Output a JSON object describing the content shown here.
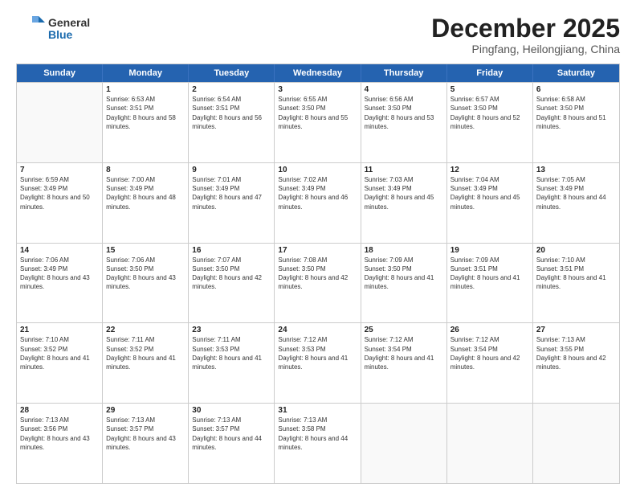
{
  "logo": {
    "general": "General",
    "blue": "Blue"
  },
  "title": "December 2025",
  "location": "Pingfang, Heilongjiang, China",
  "days_of_week": [
    "Sunday",
    "Monday",
    "Tuesday",
    "Wednesday",
    "Thursday",
    "Friday",
    "Saturday"
  ],
  "weeks": [
    [
      {
        "day": "",
        "empty": true
      },
      {
        "day": "1",
        "sunrise": "6:53 AM",
        "sunset": "3:51 PM",
        "daylight": "8 hours and 58 minutes."
      },
      {
        "day": "2",
        "sunrise": "6:54 AM",
        "sunset": "3:51 PM",
        "daylight": "8 hours and 56 minutes."
      },
      {
        "day": "3",
        "sunrise": "6:55 AM",
        "sunset": "3:50 PM",
        "daylight": "8 hours and 55 minutes."
      },
      {
        "day": "4",
        "sunrise": "6:56 AM",
        "sunset": "3:50 PM",
        "daylight": "8 hours and 53 minutes."
      },
      {
        "day": "5",
        "sunrise": "6:57 AM",
        "sunset": "3:50 PM",
        "daylight": "8 hours and 52 minutes."
      },
      {
        "day": "6",
        "sunrise": "6:58 AM",
        "sunset": "3:50 PM",
        "daylight": "8 hours and 51 minutes."
      }
    ],
    [
      {
        "day": "7",
        "sunrise": "6:59 AM",
        "sunset": "3:49 PM",
        "daylight": "8 hours and 50 minutes."
      },
      {
        "day": "8",
        "sunrise": "7:00 AM",
        "sunset": "3:49 PM",
        "daylight": "8 hours and 48 minutes."
      },
      {
        "day": "9",
        "sunrise": "7:01 AM",
        "sunset": "3:49 PM",
        "daylight": "8 hours and 47 minutes."
      },
      {
        "day": "10",
        "sunrise": "7:02 AM",
        "sunset": "3:49 PM",
        "daylight": "8 hours and 46 minutes."
      },
      {
        "day": "11",
        "sunrise": "7:03 AM",
        "sunset": "3:49 PM",
        "daylight": "8 hours and 45 minutes."
      },
      {
        "day": "12",
        "sunrise": "7:04 AM",
        "sunset": "3:49 PM",
        "daylight": "8 hours and 45 minutes."
      },
      {
        "day": "13",
        "sunrise": "7:05 AM",
        "sunset": "3:49 PM",
        "daylight": "8 hours and 44 minutes."
      }
    ],
    [
      {
        "day": "14",
        "sunrise": "7:06 AM",
        "sunset": "3:49 PM",
        "daylight": "8 hours and 43 minutes."
      },
      {
        "day": "15",
        "sunrise": "7:06 AM",
        "sunset": "3:50 PM",
        "daylight": "8 hours and 43 minutes."
      },
      {
        "day": "16",
        "sunrise": "7:07 AM",
        "sunset": "3:50 PM",
        "daylight": "8 hours and 42 minutes."
      },
      {
        "day": "17",
        "sunrise": "7:08 AM",
        "sunset": "3:50 PM",
        "daylight": "8 hours and 42 minutes."
      },
      {
        "day": "18",
        "sunrise": "7:09 AM",
        "sunset": "3:50 PM",
        "daylight": "8 hours and 41 minutes."
      },
      {
        "day": "19",
        "sunrise": "7:09 AM",
        "sunset": "3:51 PM",
        "daylight": "8 hours and 41 minutes."
      },
      {
        "day": "20",
        "sunrise": "7:10 AM",
        "sunset": "3:51 PM",
        "daylight": "8 hours and 41 minutes."
      }
    ],
    [
      {
        "day": "21",
        "sunrise": "7:10 AM",
        "sunset": "3:52 PM",
        "daylight": "8 hours and 41 minutes."
      },
      {
        "day": "22",
        "sunrise": "7:11 AM",
        "sunset": "3:52 PM",
        "daylight": "8 hours and 41 minutes."
      },
      {
        "day": "23",
        "sunrise": "7:11 AM",
        "sunset": "3:53 PM",
        "daylight": "8 hours and 41 minutes."
      },
      {
        "day": "24",
        "sunrise": "7:12 AM",
        "sunset": "3:53 PM",
        "daylight": "8 hours and 41 minutes."
      },
      {
        "day": "25",
        "sunrise": "7:12 AM",
        "sunset": "3:54 PM",
        "daylight": "8 hours and 41 minutes."
      },
      {
        "day": "26",
        "sunrise": "7:12 AM",
        "sunset": "3:54 PM",
        "daylight": "8 hours and 42 minutes."
      },
      {
        "day": "27",
        "sunrise": "7:13 AM",
        "sunset": "3:55 PM",
        "daylight": "8 hours and 42 minutes."
      }
    ],
    [
      {
        "day": "28",
        "sunrise": "7:13 AM",
        "sunset": "3:56 PM",
        "daylight": "8 hours and 43 minutes."
      },
      {
        "day": "29",
        "sunrise": "7:13 AM",
        "sunset": "3:57 PM",
        "daylight": "8 hours and 43 minutes."
      },
      {
        "day": "30",
        "sunrise": "7:13 AM",
        "sunset": "3:57 PM",
        "daylight": "8 hours and 44 minutes."
      },
      {
        "day": "31",
        "sunrise": "7:13 AM",
        "sunset": "3:58 PM",
        "daylight": "8 hours and 44 minutes."
      },
      {
        "day": "",
        "empty": true
      },
      {
        "day": "",
        "empty": true
      },
      {
        "day": "",
        "empty": true
      }
    ]
  ]
}
